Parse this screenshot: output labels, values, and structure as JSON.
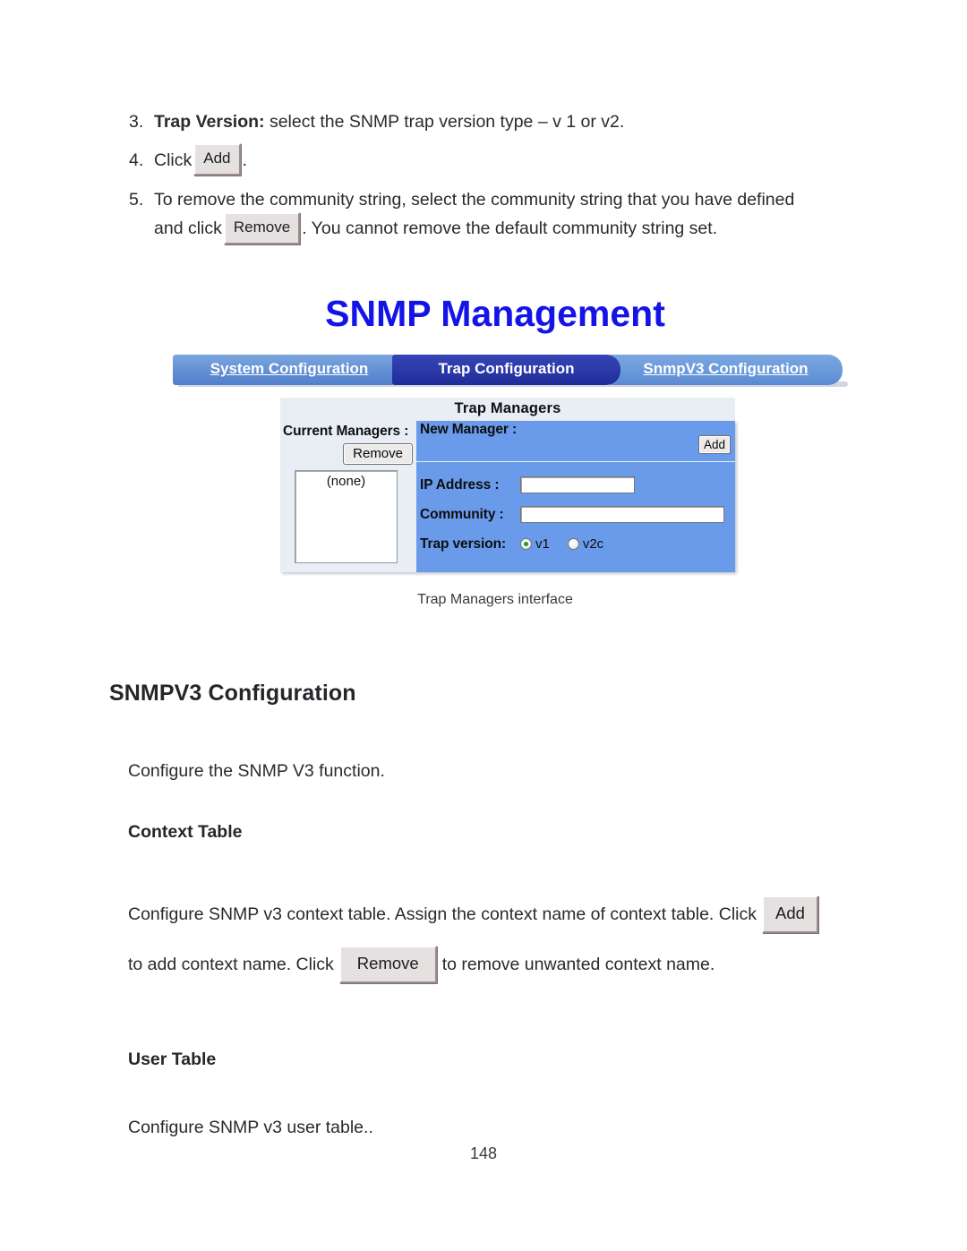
{
  "document": {
    "page_number": "148"
  },
  "steps": [
    {
      "num": "3.",
      "lead": "Trap Version:",
      "text": " select the SNMP trap version type – v 1 or v2."
    },
    {
      "num": "4.",
      "text_before": "Click",
      "button": "Add",
      "text_after": "."
    },
    {
      "num": "5.",
      "line1": "To remove the community string, select the community string that you have defined",
      "line2_before": "and click",
      "button": "Remove",
      "line2_after": ". You cannot remove the default community string set."
    }
  ],
  "figure": {
    "title": "SNMP Management",
    "tabs": [
      {
        "label": "System Configuration",
        "active": false
      },
      {
        "label": "Trap Configuration",
        "active": true
      },
      {
        "label": "SnmpV3 Configuration",
        "active": false
      }
    ],
    "panel": {
      "heading": "Trap Managers",
      "current_managers_label": "Current Managers :",
      "remove_button": "Remove",
      "list_value": "(none)",
      "new_manager_label": "New Manager :",
      "add_button": "Add",
      "fields": [
        {
          "label": "IP Address :",
          "value": ""
        },
        {
          "label": "Community :",
          "value": ""
        }
      ],
      "trap_version_label": "Trap version:",
      "trap_version_options": [
        {
          "label": "v1",
          "selected": true
        },
        {
          "label": "v2c",
          "selected": false
        }
      ]
    },
    "caption": "Trap Managers interface"
  },
  "sections": {
    "snmpv3_heading": "SNMPV3 Configuration",
    "snmpv3_intro": "Configure the SNMP V3 function.",
    "context_table_heading": "Context Table",
    "context_line1": "Configure SNMP v3 context table. Assign the context name of context table. Click",
    "context_add_button": "Add",
    "context_line2_before": "to add context name. Click",
    "context_remove_button": "Remove",
    "context_line2_after": "to remove unwanted context name.",
    "user_table_heading": "User Table",
    "user_table_intro": "Configure SNMP v3 user table.."
  },
  "colors": {
    "title_blue": "#1414e6",
    "tab_active": "#2a38a8",
    "tab_inactive": "#6a99da",
    "panel_blue": "#6a9bea",
    "panel_left": "#e9eef5",
    "radio_dot_green": "#13a613"
  }
}
